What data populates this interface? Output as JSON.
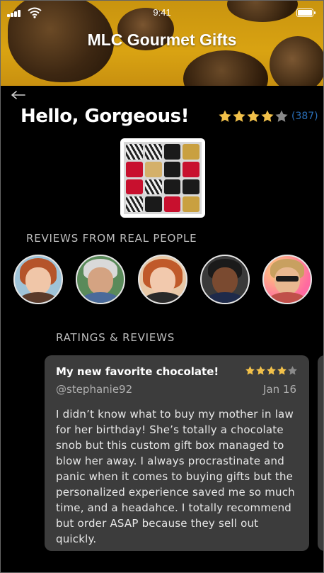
{
  "status_bar": {
    "time": "9:41"
  },
  "hero": {
    "title": "MLC Gourmet Gifts"
  },
  "page": {
    "greeting": "Hello, Gorgeous!",
    "rating": {
      "stars": 4,
      "max": 5,
      "count": "(387)"
    }
  },
  "sections": {
    "reviewers_label": "REVIEWS FROM REAL PEOPLE",
    "ratings_label": "RATINGS & REVIEWS"
  },
  "review": {
    "title": "My new favorite chocolate!",
    "user": "@stephanie92",
    "date": "Jan 16",
    "stars": 4,
    "body": "I didn’t know what to buy my mother in law for her birthday! She’s totally a chocolate snob but this custom gift box managed to blow her away. I always procrastinate and panic when it comes to buying gifts but the personalized experience saved me so much time, and a headahce. I totally recommend but order ASAP because they sell out quickly."
  },
  "icons": {
    "back": "arrow-left-icon",
    "signal": "signal-icon",
    "wifi": "wifi-icon",
    "battery": "battery-icon",
    "star": "star-icon"
  },
  "colors": {
    "star_filled": "#f2c14a",
    "star_empty": "#8a8a8a",
    "count": "#2a6fb8",
    "card_bg": "#3c3c3c",
    "hero_gold": "#d9a312"
  }
}
